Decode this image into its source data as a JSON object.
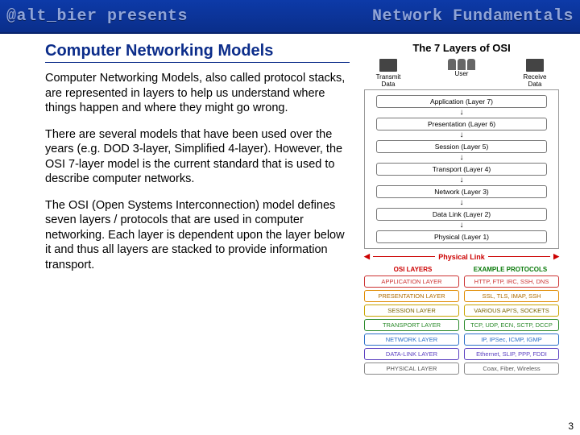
{
  "header": {
    "left": "@alt_bier presents",
    "right": "Network Fundamentals"
  },
  "title": "Computer Networking Models",
  "paragraphs": [
    "Computer Networking Models, also called protocol stacks, are represented in layers to help us understand where things happen and where they might go wrong.",
    "There are several models that have been used over the years (e.g. DOD 3-layer, Simplified 4-layer). However, the OSI 7-layer model is the current standard that is used to describe computer networks.",
    "The OSI (Open Systems Interconnection) model defines seven layers / protocols that are used in computer networking. Each layer is dependent upon the layer below it and thus all layers are stacked to provide information transport."
  ],
  "slide_number": "3",
  "osi": {
    "title": "The 7 Layers of OSI",
    "top": {
      "tx": "Transmit\nData",
      "user": "User",
      "rx": "Receive\nData"
    },
    "layers": [
      "Application (Layer 7)",
      "Presentation (Layer 6)",
      "Session (Layer 5)",
      "Transport (Layer 4)",
      "Network (Layer 3)",
      "Data Link (Layer 2)",
      "Physical (Layer 1)"
    ],
    "phys_link": "Physical Link",
    "cols": {
      "left": "OSI LAYERS",
      "right": "EXAMPLE PROTOCOLS"
    },
    "rows": [
      {
        "cls": "pr-app",
        "l": "APPLICATION LAYER",
        "r": "HTTP, FTP, IRC, SSH, DNS"
      },
      {
        "cls": "pr-pres",
        "l": "PRESENTATION LAYER",
        "r": "SSL, TLS, IMAP, SSH"
      },
      {
        "cls": "pr-sess",
        "l": "SESSION LAYER",
        "r": "VARIOUS API'S, SOCKETS"
      },
      {
        "cls": "pr-trans",
        "l": "TRANSPORT LAYER",
        "r": "TCP, UDP, ECN, SCTP, DCCP"
      },
      {
        "cls": "pr-net",
        "l": "NETWORK LAYER",
        "r": "IP, IPSec, ICMP, IGMP"
      },
      {
        "cls": "pr-link",
        "l": "DATA-LINK LAYER",
        "r": "Ethernet, SLIP, PPP, FDDI"
      },
      {
        "cls": "pr-phys",
        "l": "PHYSICAL LAYER",
        "r": "Coax, Fiber, Wireless"
      }
    ]
  }
}
